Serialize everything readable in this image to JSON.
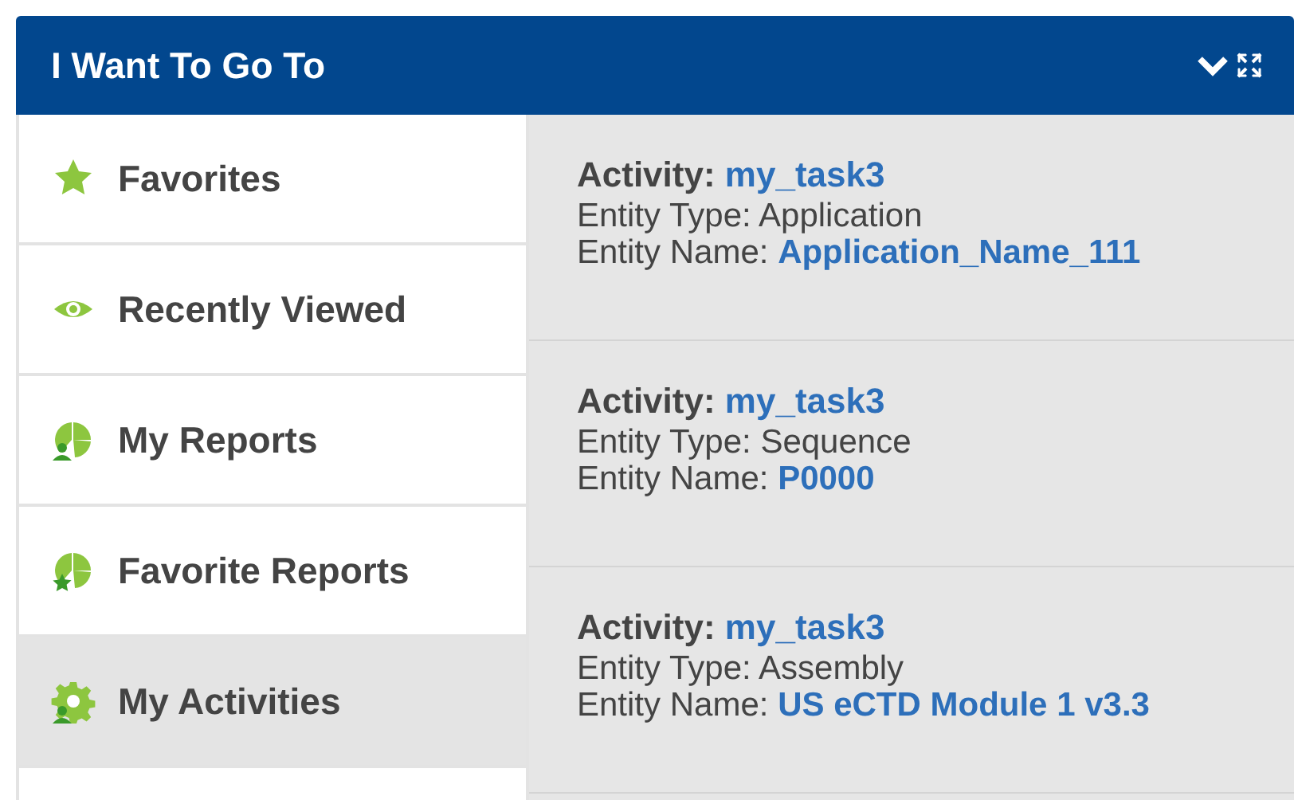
{
  "panel": {
    "title": "I Want To Go To"
  },
  "sidebar": {
    "items": [
      {
        "label": "Favorites",
        "kind": "star",
        "selected": false
      },
      {
        "label": "Recently Viewed",
        "kind": "eye",
        "selected": false
      },
      {
        "label": "My Reports",
        "kind": "report-user",
        "selected": false
      },
      {
        "label": "Favorite Reports",
        "kind": "report-star",
        "selected": false
      },
      {
        "label": "My Activities",
        "kind": "gear-user",
        "selected": true
      }
    ]
  },
  "activities": [
    {
      "activity_label": "Activity:",
      "activity": "my_task3",
      "type_label": "Entity Type:",
      "type": "Application",
      "name_label": "Entity Name:",
      "name": "Application_Name_111"
    },
    {
      "activity_label": "Activity:",
      "activity": "my_task3",
      "type_label": "Entity Type:",
      "type": "Sequence",
      "name_label": "Entity Name:",
      "name": "P0000"
    },
    {
      "activity_label": "Activity:",
      "activity": "my_task3",
      "type_label": "Entity Type:",
      "type": "Assembly",
      "name_label": "Entity Name:",
      "name": "US eCTD Module 1 v3.3"
    }
  ]
}
